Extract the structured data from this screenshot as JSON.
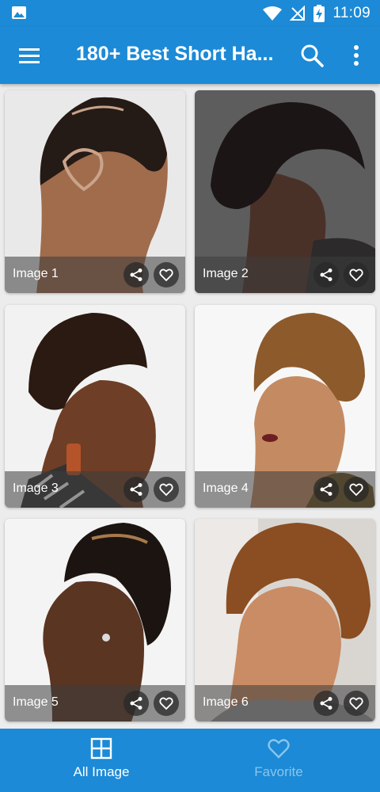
{
  "status_bar": {
    "time": "11:09",
    "icons": [
      "image-icon",
      "wifi-icon",
      "no-signal-icon",
      "battery-charging-icon"
    ]
  },
  "app_bar": {
    "title": "180+ Best Short Ha...",
    "icons": [
      "menu-icon",
      "search-icon",
      "more-vert-icon"
    ]
  },
  "cards": [
    {
      "label": "Image 1"
    },
    {
      "label": "Image 2"
    },
    {
      "label": "Image 3"
    },
    {
      "label": "Image 4"
    },
    {
      "label": "Image 5"
    },
    {
      "label": "Image 6"
    }
  ],
  "bottom_nav": {
    "items": [
      {
        "label": "All Image",
        "icon": "grid-icon",
        "active": true
      },
      {
        "label": "Favorite",
        "icon": "heart-icon",
        "active": false
      }
    ]
  },
  "colors": {
    "primary": "#1c8ad6",
    "inactive_nav": "#8cc4ea",
    "background": "#ececec"
  }
}
